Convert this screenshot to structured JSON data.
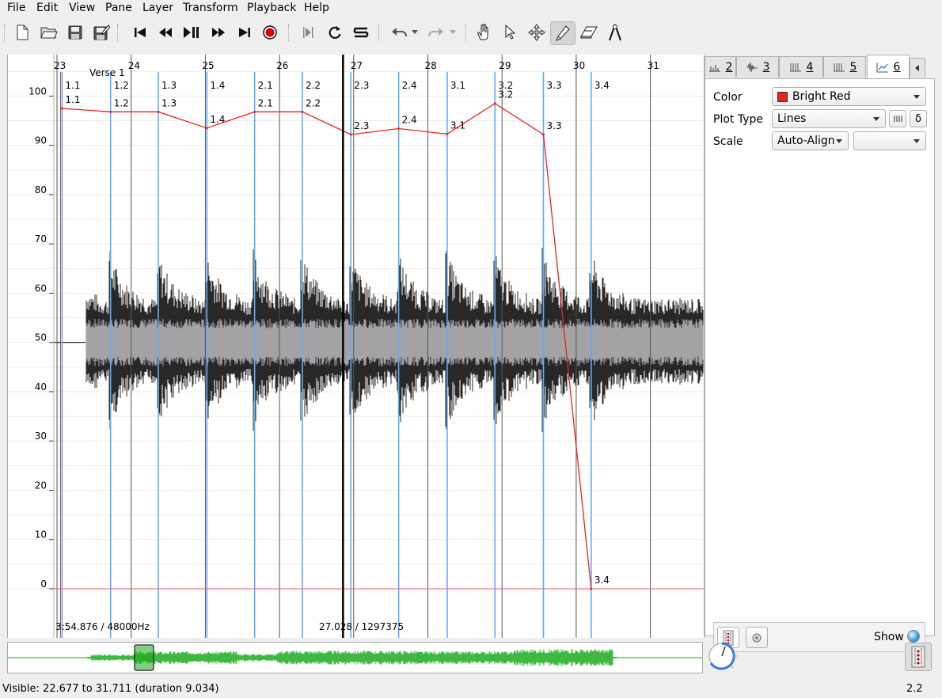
{
  "menu": [
    "File",
    "Edit",
    "View",
    "Pane",
    "Layer",
    "Transform",
    "Playback",
    "Help"
  ],
  "toolbar_icons": [
    "new-file-icon",
    "open-folder-icon",
    "save-icon",
    "save-as-icon",
    "rewind-start-icon",
    "rewind-icon",
    "play-pause-icon",
    "fast-forward-icon",
    "ffwd-end-icon",
    "record-icon",
    "play-selection-icon",
    "loop-icon",
    "solo-icon",
    "undo-icon",
    "undo-menu-icon",
    "redo-icon",
    "redo-menu-icon",
    "navigate-hand-icon",
    "select-arrow-icon",
    "move-icon",
    "draw-pencil-icon",
    "erase-icon",
    "measure-icon"
  ],
  "pane": {
    "y_axis_labels": [
      "100",
      "90",
      "80",
      "70",
      "60",
      "50",
      "40",
      "30",
      "20",
      "10",
      "0"
    ],
    "bar_numbers": [
      "23",
      "24",
      "25",
      "26",
      "27",
      "28",
      "29",
      "30",
      "31"
    ],
    "section_label": "Verse 1",
    "top_beat_labels": [
      "1.1",
      "1.2",
      "1.3",
      "1.4",
      "2.1",
      "2.2",
      "2.3",
      "2.4",
      "3.1",
      "3.2",
      "3.3",
      "3.4"
    ],
    "bottom_left_readout": "3:54.876 / 48000Hz",
    "cursor_readout": "27.028 / 1297375"
  },
  "chart_data": {
    "type": "line",
    "series": [
      {
        "x": [
          23.38,
          24.01,
          24.63,
          25.26,
          25.88,
          26.5,
          27.13,
          27.75,
          28.38,
          29.0,
          29.63,
          30.25
        ],
        "values": [
          97.5,
          96.8,
          96.8,
          93.5,
          96.8,
          96.8,
          92.2,
          93.4,
          92.3,
          98.5,
          92.2,
          0
        ],
        "labels": [
          "1.1",
          "1.2",
          "1.3",
          "1.4",
          "2.1",
          "2.2",
          "2.3",
          "2.4",
          "3.1",
          "3.2",
          "3.3",
          "3.4"
        ],
        "color": "#e8231c"
      }
    ],
    "xlim": [
      22.677,
      31.711
    ],
    "ylim": [
      -9,
      108
    ],
    "y_ticks": [
      0,
      10,
      20,
      30,
      40,
      50,
      60,
      70,
      80,
      90,
      100
    ],
    "grid": true
  },
  "properties": {
    "tabs": [
      {
        "num": "2",
        "icon": "ruler-layer-icon"
      },
      {
        "num": "3",
        "icon": "waveform-layer-icon"
      },
      {
        "num": "4",
        "icon": "time-instants-icon"
      },
      {
        "num": "5",
        "icon": "time-instants-icon"
      },
      {
        "num": "6",
        "icon": "time-values-icon"
      }
    ],
    "color_label": "Color",
    "color_value": "Bright Red",
    "color_swatch": "#e8231c",
    "plot_type_label": "Plot Type",
    "plot_type_value": "Lines",
    "delta_button": "δ",
    "scale_label": "Scale",
    "scale_value": "Auto-Align",
    "scale_secondary": "",
    "show_label": "Show"
  },
  "status": {
    "visible_text": "Visible: 22.677 to 31.711 (duration 9.034)",
    "right_text": "2.2"
  }
}
